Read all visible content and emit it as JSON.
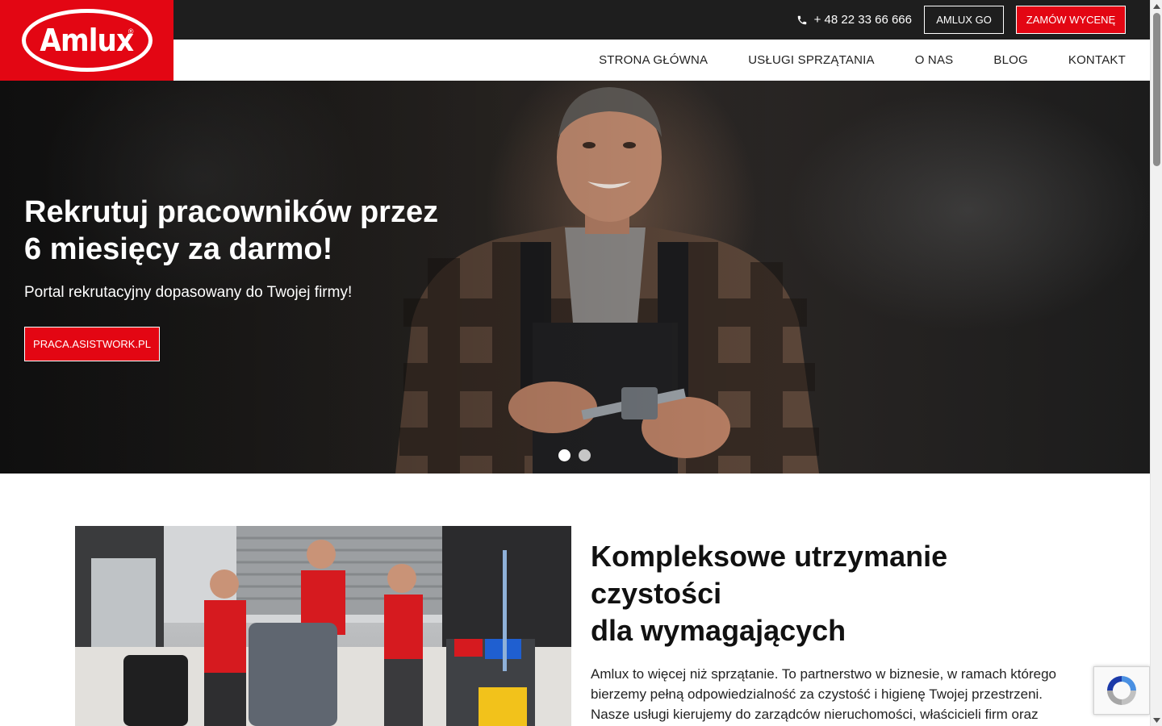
{
  "header": {
    "logo_text": "Amlux",
    "logo_reg": "®",
    "phone": "+ 48 22 33 66 666",
    "amlux_go_label": "AMLUX GO",
    "order_label": "ZAMÓW WYCENĘ"
  },
  "nav": {
    "items": [
      {
        "label": "STRONA GŁÓWNA"
      },
      {
        "label": "USŁUGI SPRZĄTANIA"
      },
      {
        "label": "O NAS"
      },
      {
        "label": "BLOG"
      },
      {
        "label": "KONTAKT"
      }
    ]
  },
  "hero": {
    "title_line1": "Rekrutuj pracowników przez",
    "title_line2": "6 miesięcy za darmo!",
    "subtitle": "Portal rekrutacyjny dopasowany do Twojej firmy!",
    "cta_label": "PRACA.ASISTWORK.PL",
    "slides": 2,
    "active_slide": 1
  },
  "section": {
    "title_line1": "Kompleksowe utrzymanie",
    "title_line2": "czystości",
    "title_line3": "dla wymagających",
    "text": "Amlux to więcej niż sprzątanie. To partnerstwo w biznesie, w ramach którego bierzemy pełną odpowiedzialność za czystość i higienę Twojej przestrzeni. Nasze usługi kierujemy do zarządców nieruchomości, właścicieli firm oraz managerów"
  },
  "colors": {
    "brand_red": "#e30613",
    "topbar": "#1e1e1e"
  },
  "icons": [
    "phone-icon",
    "recaptcha-icon",
    "scroll-up-icon",
    "scroll-down-icon"
  ]
}
